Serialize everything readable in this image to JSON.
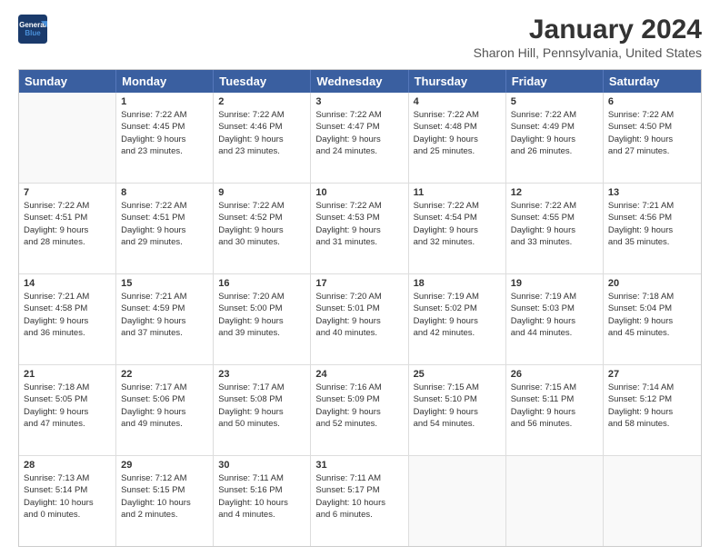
{
  "logo": {
    "line1": "General",
    "line2": "Blue"
  },
  "title": "January 2024",
  "subtitle": "Sharon Hill, Pennsylvania, United States",
  "header_days": [
    "Sunday",
    "Monday",
    "Tuesday",
    "Wednesday",
    "Thursday",
    "Friday",
    "Saturday"
  ],
  "weeks": [
    [
      {
        "num": "",
        "lines": []
      },
      {
        "num": "1",
        "lines": [
          "Sunrise: 7:22 AM",
          "Sunset: 4:45 PM",
          "Daylight: 9 hours",
          "and 23 minutes."
        ]
      },
      {
        "num": "2",
        "lines": [
          "Sunrise: 7:22 AM",
          "Sunset: 4:46 PM",
          "Daylight: 9 hours",
          "and 23 minutes."
        ]
      },
      {
        "num": "3",
        "lines": [
          "Sunrise: 7:22 AM",
          "Sunset: 4:47 PM",
          "Daylight: 9 hours",
          "and 24 minutes."
        ]
      },
      {
        "num": "4",
        "lines": [
          "Sunrise: 7:22 AM",
          "Sunset: 4:48 PM",
          "Daylight: 9 hours",
          "and 25 minutes."
        ]
      },
      {
        "num": "5",
        "lines": [
          "Sunrise: 7:22 AM",
          "Sunset: 4:49 PM",
          "Daylight: 9 hours",
          "and 26 minutes."
        ]
      },
      {
        "num": "6",
        "lines": [
          "Sunrise: 7:22 AM",
          "Sunset: 4:50 PM",
          "Daylight: 9 hours",
          "and 27 minutes."
        ]
      }
    ],
    [
      {
        "num": "7",
        "lines": [
          "Sunrise: 7:22 AM",
          "Sunset: 4:51 PM",
          "Daylight: 9 hours",
          "and 28 minutes."
        ]
      },
      {
        "num": "8",
        "lines": [
          "Sunrise: 7:22 AM",
          "Sunset: 4:51 PM",
          "Daylight: 9 hours",
          "and 29 minutes."
        ]
      },
      {
        "num": "9",
        "lines": [
          "Sunrise: 7:22 AM",
          "Sunset: 4:52 PM",
          "Daylight: 9 hours",
          "and 30 minutes."
        ]
      },
      {
        "num": "10",
        "lines": [
          "Sunrise: 7:22 AM",
          "Sunset: 4:53 PM",
          "Daylight: 9 hours",
          "and 31 minutes."
        ]
      },
      {
        "num": "11",
        "lines": [
          "Sunrise: 7:22 AM",
          "Sunset: 4:54 PM",
          "Daylight: 9 hours",
          "and 32 minutes."
        ]
      },
      {
        "num": "12",
        "lines": [
          "Sunrise: 7:22 AM",
          "Sunset: 4:55 PM",
          "Daylight: 9 hours",
          "and 33 minutes."
        ]
      },
      {
        "num": "13",
        "lines": [
          "Sunrise: 7:21 AM",
          "Sunset: 4:56 PM",
          "Daylight: 9 hours",
          "and 35 minutes."
        ]
      }
    ],
    [
      {
        "num": "14",
        "lines": [
          "Sunrise: 7:21 AM",
          "Sunset: 4:58 PM",
          "Daylight: 9 hours",
          "and 36 minutes."
        ]
      },
      {
        "num": "15",
        "lines": [
          "Sunrise: 7:21 AM",
          "Sunset: 4:59 PM",
          "Daylight: 9 hours",
          "and 37 minutes."
        ]
      },
      {
        "num": "16",
        "lines": [
          "Sunrise: 7:20 AM",
          "Sunset: 5:00 PM",
          "Daylight: 9 hours",
          "and 39 minutes."
        ]
      },
      {
        "num": "17",
        "lines": [
          "Sunrise: 7:20 AM",
          "Sunset: 5:01 PM",
          "Daylight: 9 hours",
          "and 40 minutes."
        ]
      },
      {
        "num": "18",
        "lines": [
          "Sunrise: 7:19 AM",
          "Sunset: 5:02 PM",
          "Daylight: 9 hours",
          "and 42 minutes."
        ]
      },
      {
        "num": "19",
        "lines": [
          "Sunrise: 7:19 AM",
          "Sunset: 5:03 PM",
          "Daylight: 9 hours",
          "and 44 minutes."
        ]
      },
      {
        "num": "20",
        "lines": [
          "Sunrise: 7:18 AM",
          "Sunset: 5:04 PM",
          "Daylight: 9 hours",
          "and 45 minutes."
        ]
      }
    ],
    [
      {
        "num": "21",
        "lines": [
          "Sunrise: 7:18 AM",
          "Sunset: 5:05 PM",
          "Daylight: 9 hours",
          "and 47 minutes."
        ]
      },
      {
        "num": "22",
        "lines": [
          "Sunrise: 7:17 AM",
          "Sunset: 5:06 PM",
          "Daylight: 9 hours",
          "and 49 minutes."
        ]
      },
      {
        "num": "23",
        "lines": [
          "Sunrise: 7:17 AM",
          "Sunset: 5:08 PM",
          "Daylight: 9 hours",
          "and 50 minutes."
        ]
      },
      {
        "num": "24",
        "lines": [
          "Sunrise: 7:16 AM",
          "Sunset: 5:09 PM",
          "Daylight: 9 hours",
          "and 52 minutes."
        ]
      },
      {
        "num": "25",
        "lines": [
          "Sunrise: 7:15 AM",
          "Sunset: 5:10 PM",
          "Daylight: 9 hours",
          "and 54 minutes."
        ]
      },
      {
        "num": "26",
        "lines": [
          "Sunrise: 7:15 AM",
          "Sunset: 5:11 PM",
          "Daylight: 9 hours",
          "and 56 minutes."
        ]
      },
      {
        "num": "27",
        "lines": [
          "Sunrise: 7:14 AM",
          "Sunset: 5:12 PM",
          "Daylight: 9 hours",
          "and 58 minutes."
        ]
      }
    ],
    [
      {
        "num": "28",
        "lines": [
          "Sunrise: 7:13 AM",
          "Sunset: 5:14 PM",
          "Daylight: 10 hours",
          "and 0 minutes."
        ]
      },
      {
        "num": "29",
        "lines": [
          "Sunrise: 7:12 AM",
          "Sunset: 5:15 PM",
          "Daylight: 10 hours",
          "and 2 minutes."
        ]
      },
      {
        "num": "30",
        "lines": [
          "Sunrise: 7:11 AM",
          "Sunset: 5:16 PM",
          "Daylight: 10 hours",
          "and 4 minutes."
        ]
      },
      {
        "num": "31",
        "lines": [
          "Sunrise: 7:11 AM",
          "Sunset: 5:17 PM",
          "Daylight: 10 hours",
          "and 6 minutes."
        ]
      },
      {
        "num": "",
        "lines": []
      },
      {
        "num": "",
        "lines": []
      },
      {
        "num": "",
        "lines": []
      }
    ]
  ]
}
